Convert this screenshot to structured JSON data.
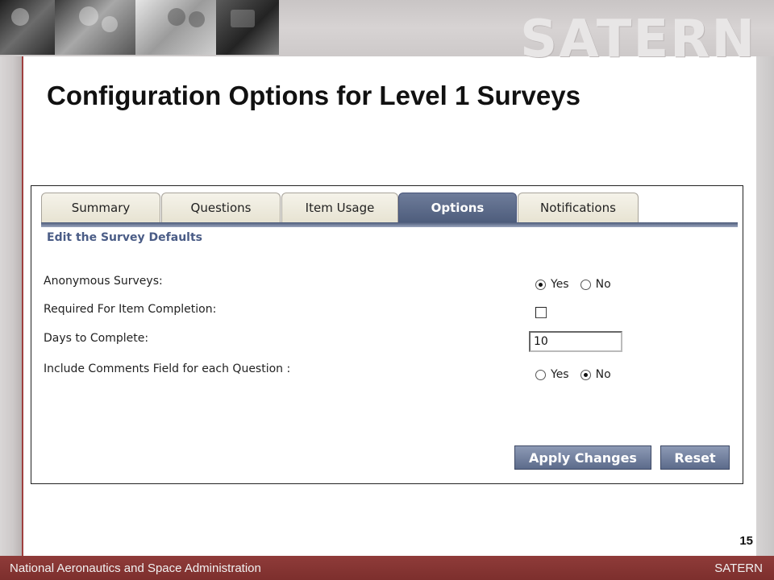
{
  "header": {
    "logo_text": "SATERN"
  },
  "slide": {
    "title": "Configuration Options for Level 1 Surveys",
    "page_number": "15"
  },
  "tabs": [
    {
      "label": "Summary",
      "active": false
    },
    {
      "label": "Questions",
      "active": false
    },
    {
      "label": "Item Usage",
      "active": false
    },
    {
      "label": "Options",
      "active": true
    },
    {
      "label": "Notifications",
      "active": false
    }
  ],
  "section_title": "Edit the Survey Defaults",
  "fields": {
    "anonymous": {
      "label": "Anonymous Surveys:",
      "options": [
        "Yes",
        "No"
      ],
      "selected": "Yes"
    },
    "required": {
      "label": "Required For Item Completion:",
      "checked": false
    },
    "days": {
      "label": "Days to Complete:",
      "value": "10"
    },
    "comments": {
      "label": "Include Comments Field for each Question :",
      "options": [
        "Yes",
        "No"
      ],
      "selected": "No"
    }
  },
  "buttons": {
    "apply": "Apply Changes",
    "reset": "Reset"
  },
  "footer": {
    "org": "National Aeronautics and Space Administration",
    "brand": "SATERN"
  },
  "colors": {
    "footer_bg": "#8f3b39",
    "active_tab": "#5a6888",
    "section_title": "#4a5c86"
  }
}
